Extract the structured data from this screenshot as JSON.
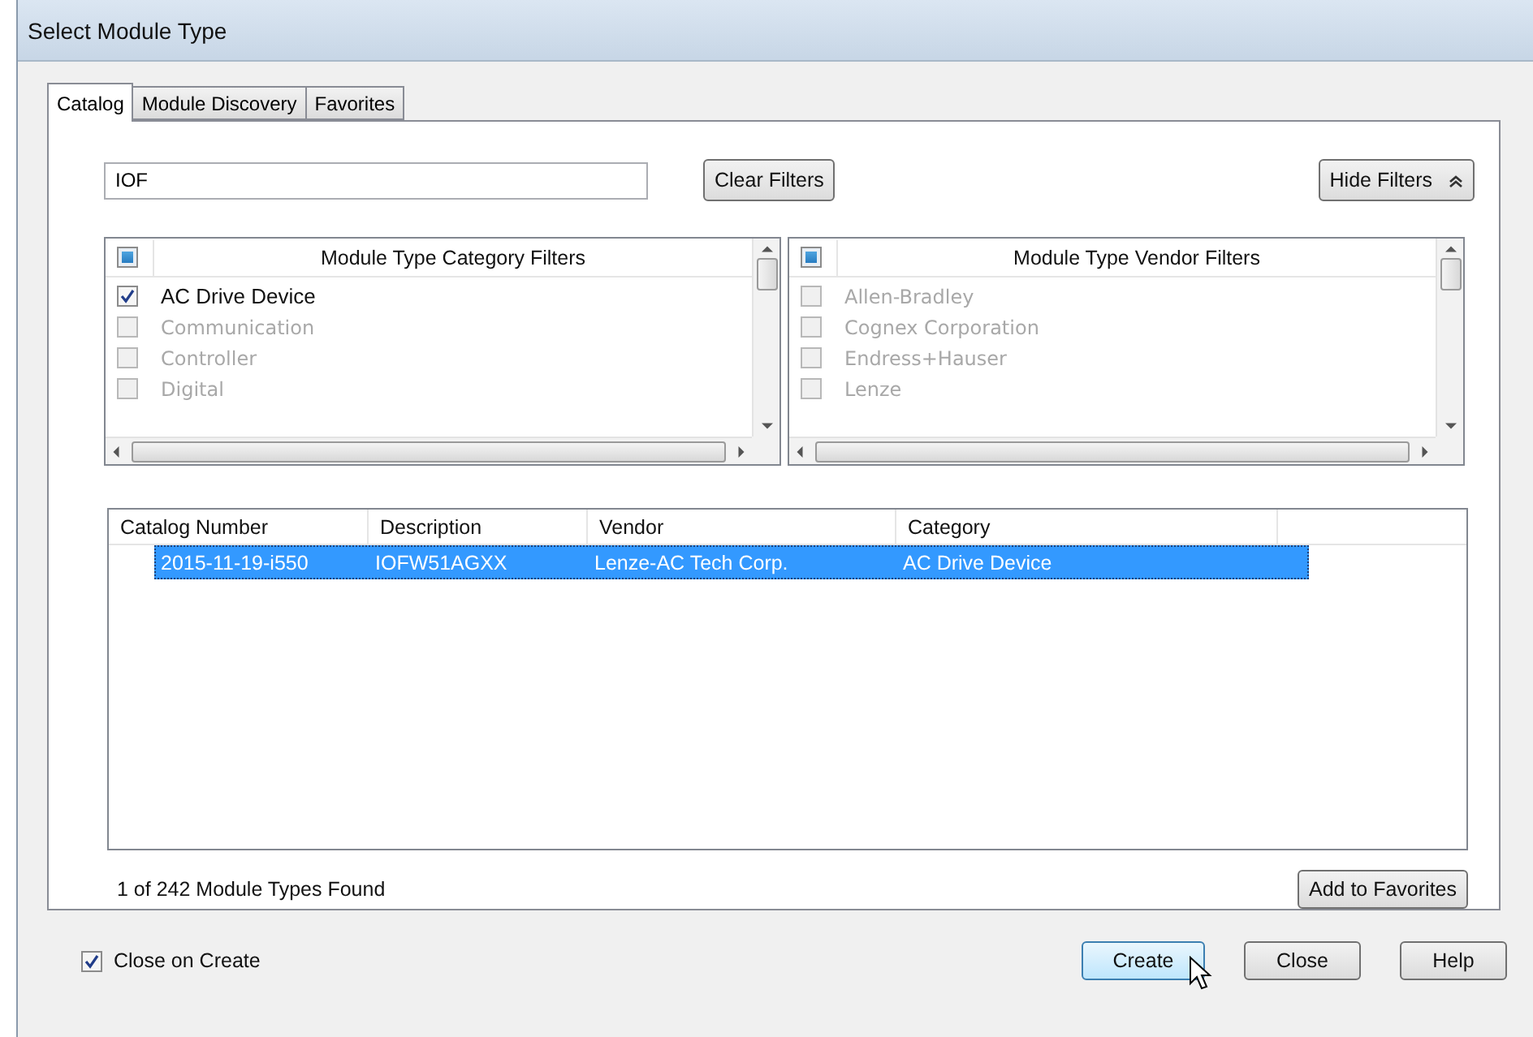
{
  "window": {
    "title": "Select Module Type"
  },
  "tabs": [
    {
      "label": "Catalog",
      "selected": true
    },
    {
      "label": "Module Discovery",
      "selected": false
    },
    {
      "label": "Favorites",
      "selected": false
    }
  ],
  "search": {
    "value": "IOF"
  },
  "clear_filters_button": "Clear Filters",
  "hide_filters_button": "Hide Filters",
  "filter_lists": [
    {
      "title": "Module Type Category Filters",
      "select_all_partial": true,
      "items": [
        {
          "label": "AC Drive Device",
          "checked": true,
          "disabled": false
        },
        {
          "label": "Communication",
          "checked": false,
          "disabled": true
        },
        {
          "label": "Controller",
          "checked": false,
          "disabled": true
        },
        {
          "label": "Digital",
          "checked": false,
          "disabled": true
        }
      ]
    },
    {
      "title": "Module Type Vendor Filters",
      "select_all_partial": true,
      "items": [
        {
          "label": "Allen-Bradley",
          "checked": false,
          "disabled": true
        },
        {
          "label": "Cognex Corporation",
          "checked": false,
          "disabled": true
        },
        {
          "label": "Endress+Hauser",
          "checked": false,
          "disabled": true
        },
        {
          "label": "Lenze",
          "checked": false,
          "disabled": true
        }
      ]
    }
  ],
  "table": {
    "columns": [
      "Catalog Number",
      "Description",
      "Vendor",
      "Category"
    ],
    "rows": [
      {
        "cells": [
          "2015-11-19-i550",
          "IOFW51AGXX",
          "Lenze-AC Tech Corp.",
          "AC Drive Device"
        ],
        "selected": true
      }
    ]
  },
  "status": "1 of 242 Module Types Found",
  "add_to_favorites_button": "Add to Favorites",
  "close_on_create": {
    "label": "Close on Create",
    "checked": true
  },
  "buttons": [
    "Create",
    "Close",
    "Help"
  ]
}
